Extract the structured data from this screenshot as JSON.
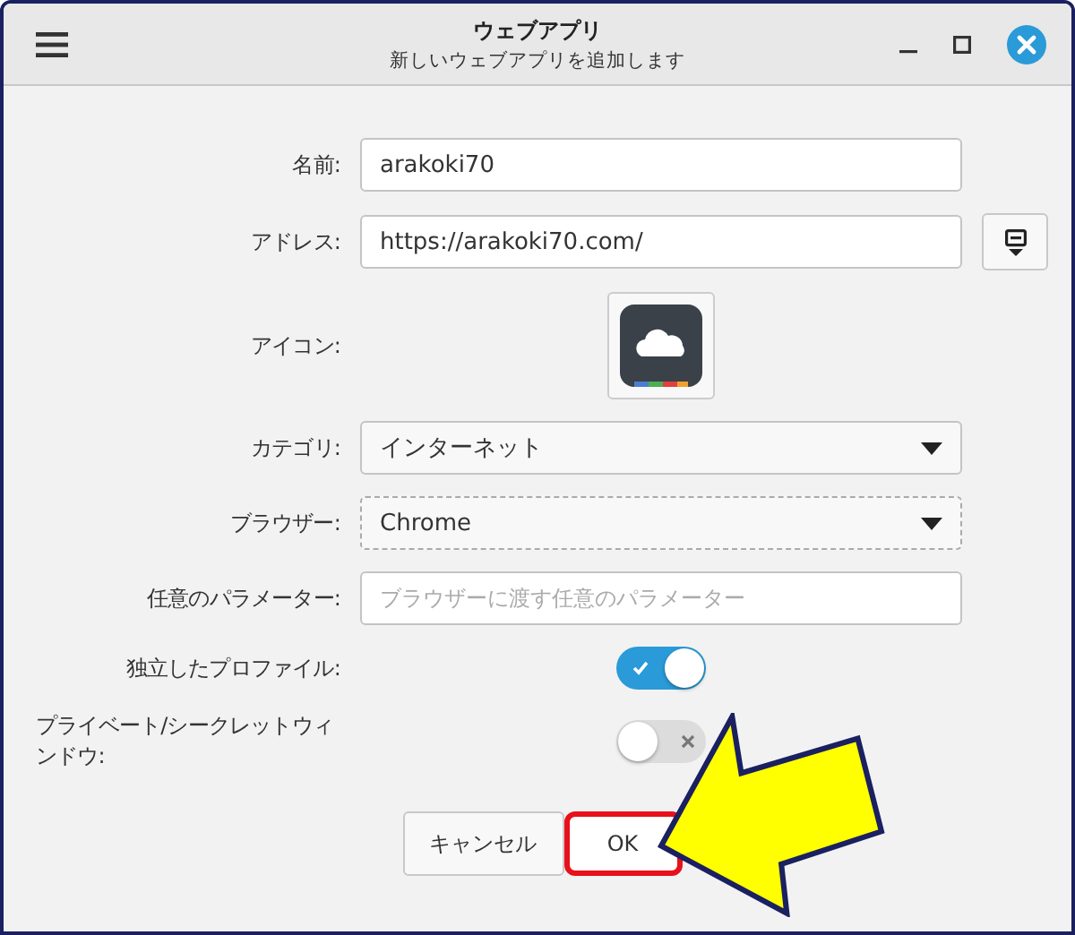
{
  "window": {
    "title": "ウェブアプリ",
    "subtitle": "新しいウェブアプリを追加します"
  },
  "form": {
    "rows": [
      {
        "kind": "text",
        "label": "名前:",
        "value": "arakoki70"
      },
      {
        "kind": "address",
        "label": "アドレス:",
        "value": "https://arakoki70.com/"
      },
      {
        "kind": "icon",
        "label": "アイコン:"
      },
      {
        "kind": "select",
        "label": "カテゴリ:",
        "value": "インターネット",
        "focused": false
      },
      {
        "kind": "select",
        "label": "ブラウザー:",
        "value": "Chrome",
        "focused": true
      },
      {
        "kind": "text",
        "label": "任意のパラメーター:",
        "placeholder": "ブラウザーに渡す任意のパラメーター"
      },
      {
        "kind": "toggle",
        "label": "独立したプロファイル:",
        "on": true
      },
      {
        "kind": "toggle",
        "label": "プライベート/シークレットウィンドウ:",
        "on": false
      }
    ]
  },
  "buttons": [
    {
      "label": "キャンセル",
      "highlighted": false
    },
    {
      "label": "OK",
      "highlighted": true
    }
  ]
}
